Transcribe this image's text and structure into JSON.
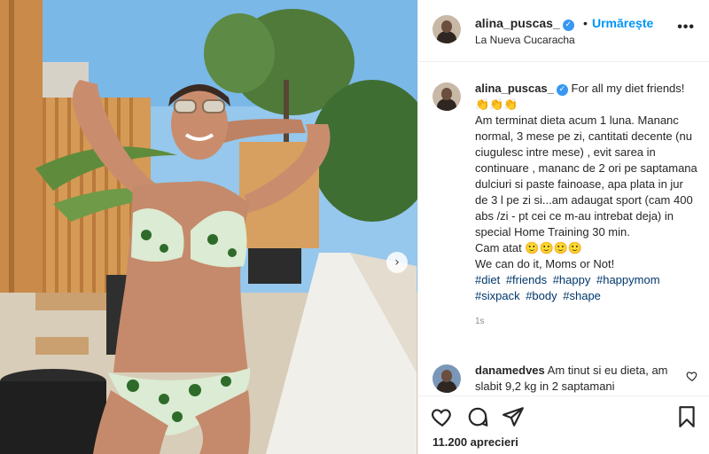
{
  "post": {
    "username": "alina_puscas_",
    "verified_icon": "verified-badge-icon",
    "separator": "•",
    "follow_label": "Urmărește",
    "location": "La Nueva Cucaracha",
    "more_icon": "more-options-icon",
    "more_glyph": "•••"
  },
  "caption": {
    "username": "alina_puscas_",
    "text": "For all my diet friends! 👏👏👏\nAm terminat dieta acum 1 luna. Mananc normal, 3 mese pe zi, cantitati decente (nu ciugulesc intre mese) , evit sarea in continuare , mananc de 2 ori pe saptamana dulciuri si paste fainoase, apa plata in jur de 3 l pe zi si...am adaugat sport (cam 400 abs /zi - pt cei ce m-au intrebat deja) in special Home Training 30 min.\nCam atat 🙂🙂🙂🙂\nWe can do it, Moms or Not!",
    "hashtags": [
      "#diet",
      "#friends",
      "#happy",
      "#happymom",
      "#sixpack",
      "#body",
      "#shape"
    ],
    "time": "1s"
  },
  "comments": [
    {
      "username": "danamedves",
      "text": "Am tinut si eu dieta, am slabit 9,2 kg in 2 saptamani"
    }
  ],
  "actions": {
    "like_icon": "heart-icon",
    "comment_icon": "comment-icon",
    "share_icon": "share-icon",
    "save_icon": "bookmark-icon",
    "likes_text": "11.200 aprecieri"
  },
  "photo": {
    "next_glyph": "›"
  },
  "colors": {
    "link": "#0095f6",
    "hashtag": "#00376b",
    "text": "#262626",
    "muted": "#8e8e8e",
    "border": "#efefef"
  }
}
